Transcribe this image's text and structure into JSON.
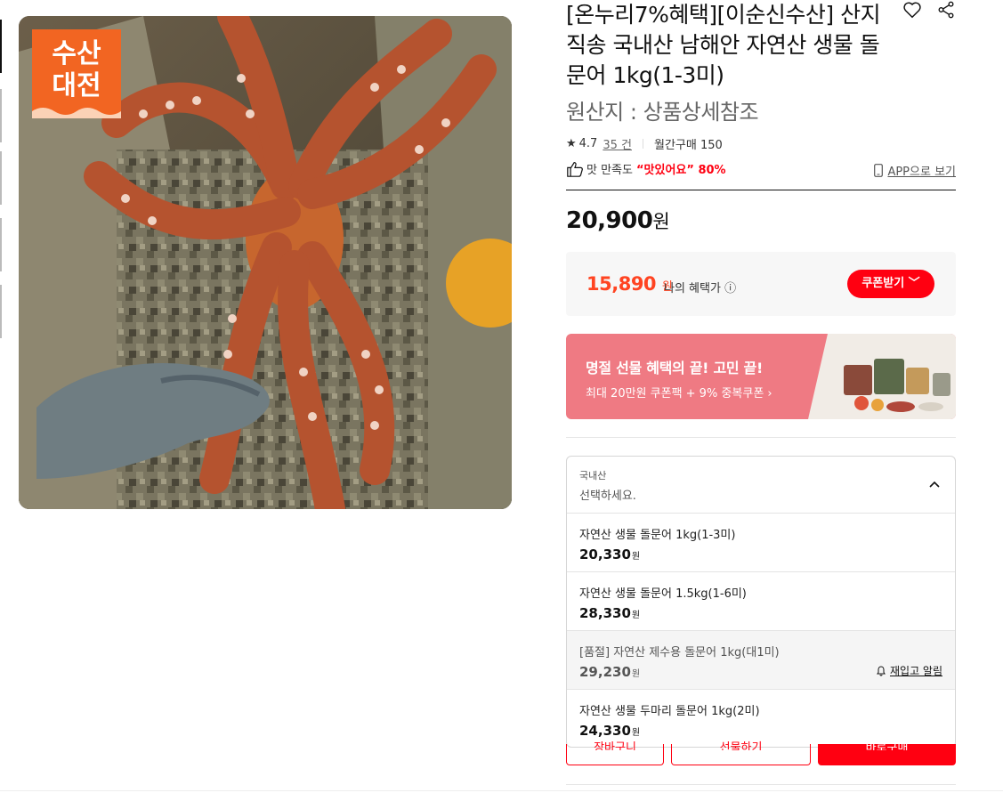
{
  "product": {
    "badge_line1": "수산",
    "badge_line2": "대전",
    "image_alt": "돌문어",
    "title": "[온누리7%혜택][이순신수산] 산지직송 국내산 남해안 자연산 생물 돌문어 1kg(1-3미)",
    "origin": "원산지 : 상품상세참조"
  },
  "icons": {
    "wish": "heart-icon",
    "share": "share-icon",
    "star": "star-icon",
    "thumb": "thumbs-up-icon",
    "phone": "phone-icon",
    "chevron": "chevron-up-icon",
    "bell": "bell-icon"
  },
  "rating": {
    "star": "★",
    "score": "4.7",
    "count": "35 건",
    "monthly": "월간구매 150"
  },
  "taste": {
    "label": "맛 만족도",
    "quote": "“맛있어요” 80%"
  },
  "app_link": "APP으로 보기",
  "price": {
    "value": "20,900",
    "unit": "원"
  },
  "benefit": {
    "price": "15,890",
    "unit": "원",
    "label": "나의 혜택가 ⓘ",
    "coupon_button": "쿠폰받기 ﹀"
  },
  "banner": {
    "headline": "명절 선물 혜택의 끝! 고민 끝!",
    "sub": "최대 20만원 쿠폰팩 + 9% 중복쿠폰 ›"
  },
  "dropdown": {
    "category": "국내산",
    "placeholder": "선택하세요.",
    "options": [
      {
        "name": "자연산 생물 돌문어 1kg(1-3미)",
        "price": "20,330",
        "unit": "원",
        "sold_out": false
      },
      {
        "name": "자연산 생물 돌문어 1.5kg(1-6미)",
        "price": "28,330",
        "unit": "원",
        "sold_out": false
      },
      {
        "name": "[품절] 자연산 제수용 돌문어 1kg(대1미)",
        "price": "29,230",
        "unit": "원",
        "sold_out": true,
        "alert": "재입고 알림"
      },
      {
        "name": "자연산 생물 두마리 돌문어 1kg(2미)",
        "price": "24,330",
        "unit": "원",
        "sold_out": false
      }
    ]
  },
  "buttons": {
    "cart": "장바구니",
    "gift": "선물하기",
    "buy": "바로구매"
  },
  "colors": {
    "accent": "#ff0011",
    "badge": "#f26522",
    "banner": "#ef7a83"
  }
}
